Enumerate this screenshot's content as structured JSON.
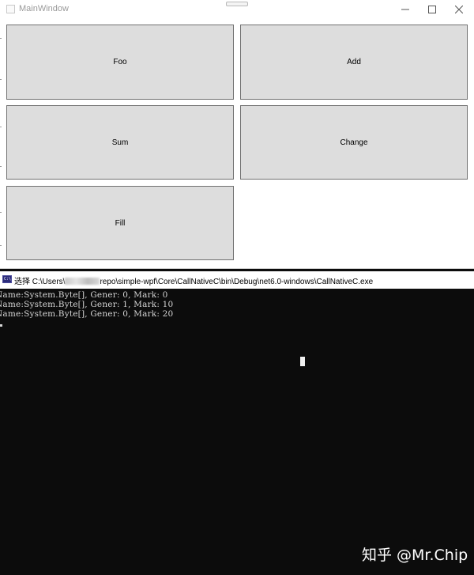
{
  "main_window": {
    "title": "MainWindow",
    "controls": {
      "minimize_icon": "minimize-icon",
      "maximize_icon": "maximize-icon",
      "close_icon": "close-icon"
    },
    "buttons": [
      {
        "id": "foo",
        "label": "Foo"
      },
      {
        "id": "add",
        "label": "Add"
      },
      {
        "id": "sum",
        "label": "Sum"
      },
      {
        "id": "change",
        "label": "Change"
      },
      {
        "id": "fill",
        "label": "Fill"
      }
    ],
    "button_color": "#dddddd",
    "button_border_color": "#707070"
  },
  "console_window": {
    "title_prefix": "选择 C:\\Users\\",
    "title_suffix": "repo\\simple-wpf\\Core\\CallNativeC\\bin\\Debug\\net6.0-windows\\CallNativeC.exe",
    "icon": "console-icon",
    "lines": [
      "Name:System.Byte[], Gener: 0, Mark: 0",
      "Name:System.Byte[], Gener: 1, Mark: 10",
      "Name:System.Byte[], Gener: 0, Mark: 20"
    ],
    "background_color": "#0c0c0c",
    "text_color": "#d6d6d6"
  },
  "watermark": "知乎 @Mr.Chip"
}
